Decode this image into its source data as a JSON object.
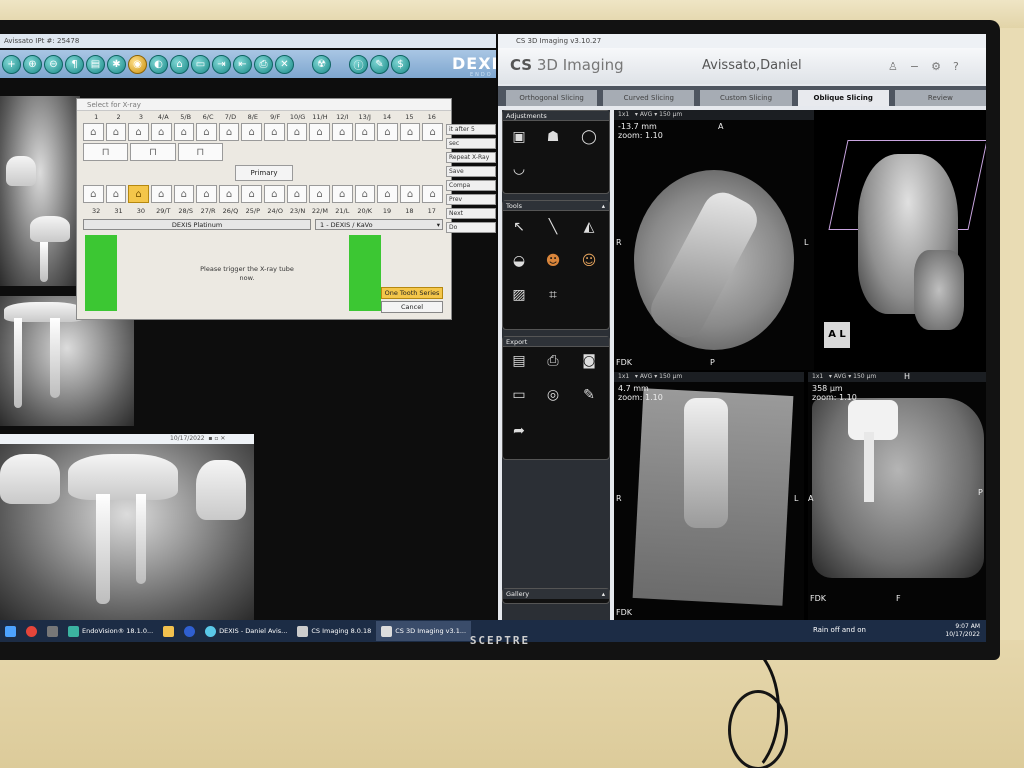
{
  "left_app": {
    "title": "Avissato IPt #: 25478",
    "brand": "DEXIS",
    "brand_sub": "ENDO",
    "xray_date": "10/17/2022"
  },
  "dialog": {
    "title": "Select for X-ray",
    "upper_numbers": [
      "1",
      "2",
      "3",
      "4/A",
      "5/B",
      "6/C",
      "7/D",
      "8/E",
      "9/F",
      "10/G",
      "11/H",
      "12/I",
      "13/J",
      "14",
      "15",
      "16"
    ],
    "lower_numbers": [
      "32",
      "31",
      "30",
      "29/T",
      "28/S",
      "27/R",
      "26/Q",
      "25/P",
      "24/O",
      "23/N",
      "22/M",
      "21/L",
      "20/K",
      "19",
      "18",
      "17"
    ],
    "primary_label": "Primary",
    "sensor_left": "DEXIS Platinum",
    "sensor_right": "1 - DEXIS / KaVo",
    "trigger_text": "Please trigger the X-ray tube now.",
    "one_tooth_label": "One Tooth Series",
    "cancel_label": "Cancel"
  },
  "side_list": [
    "it after 5",
    "sec",
    "Repeat X-Ray",
    "Save",
    "Compa",
    "Prev",
    "Next",
    "Do"
  ],
  "right_app": {
    "window_title": "CS 3D Imaging v3.10.27",
    "logo_a": "CS",
    "logo_b": "3D Imaging",
    "patient": "Avissato,Daniel",
    "tabs": [
      "Orthogonal Slicing",
      "Curved Slicing",
      "Custom Slicing",
      "Oblique Slicing",
      "Review"
    ],
    "active_tab": "Oblique Slicing"
  },
  "panels": {
    "adjustments": "Adjustments",
    "tools": "Tools",
    "export": "Export",
    "gallery": "Gallery"
  },
  "views": {
    "v1_info": "-13.7 mm\nzoom: 1.10",
    "v1_top": "A",
    "v1_left": "R",
    "v1_right": "L",
    "v1_bl": "FDK",
    "v1_bottom": "P",
    "v2_info": "4.7 mm\nzoom: 1.10",
    "v2_left": "R",
    "v2_right": "L",
    "v2_bl": "FDK",
    "v3_info": "358 µm\nzoom: 1.10",
    "v3_left": "A",
    "v3_right": "P",
    "v3_top": "H",
    "v3_bl": "FDK",
    "v3_bottom": "F",
    "bar_1x1": "1x1",
    "bar_avg": "AVG",
    "bar_um": "150 µm"
  },
  "taskbar": {
    "items": [
      "EndoVision® 18.1.0...",
      "DEXIS - Daniel Avis...",
      "CS Imaging 8.0.18",
      "CS 3D Imaging v3.1..."
    ],
    "weather": "Rain off and on",
    "time": "9:07 AM",
    "date": "10/17/2022"
  },
  "monitor_brand": "SCEPTRE",
  "colors": {
    "accent_gold": "#f4c64a",
    "green": "#3cc733",
    "teal": "#1b8a88",
    "taskbar": "#1c2c45"
  }
}
